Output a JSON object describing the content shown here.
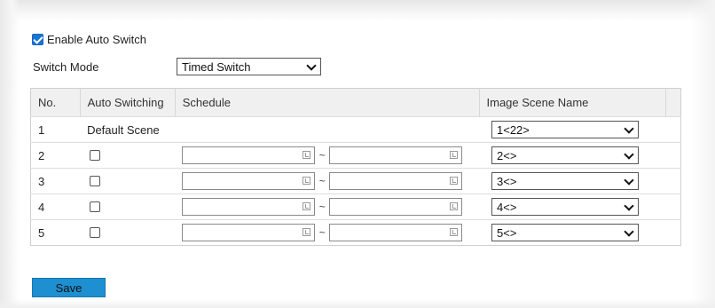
{
  "enable_auto_switch": {
    "label": "Enable Auto Switch",
    "checked": true
  },
  "switch_mode": {
    "label": "Switch Mode",
    "value": "Timed Switch"
  },
  "table": {
    "headers": [
      "No.",
      "Auto Switching",
      "Schedule",
      "Image Scene Name"
    ],
    "default_row": {
      "no": "1",
      "auto": "Default Scene",
      "scene": "1<22>"
    },
    "rows": [
      {
        "no": "2",
        "scene": "2<>"
      },
      {
        "no": "3",
        "scene": "3<>"
      },
      {
        "no": "4",
        "scene": "4<>"
      },
      {
        "no": "5",
        "scene": "5<>"
      }
    ],
    "range_separator": "~"
  },
  "save_button": {
    "label": "Save"
  },
  "colors": {
    "accent": "#1976d2",
    "save_bg": "#1e8fd0",
    "header_bg": "#f0f0f0"
  }
}
